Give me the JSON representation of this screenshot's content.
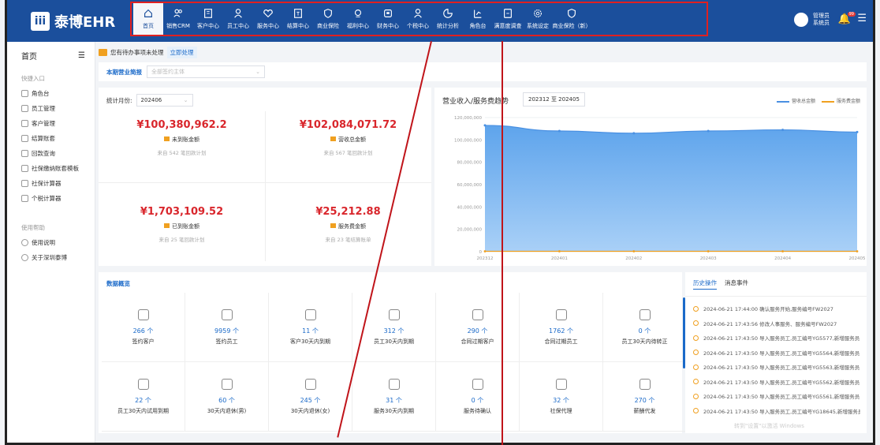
{
  "brand": {
    "name": "泰博EHR",
    "mark": "iii"
  },
  "nav": [
    {
      "label": "首页",
      "icon": "home-icon",
      "active": true
    },
    {
      "label": "销售CRM",
      "icon": "people-icon"
    },
    {
      "label": "客户中心",
      "icon": "building-icon"
    },
    {
      "label": "员工中心",
      "icon": "person-icon"
    },
    {
      "label": "服务中心",
      "icon": "heart-icon"
    },
    {
      "label": "结算中心",
      "icon": "invoice-icon"
    },
    {
      "label": "商业保险",
      "icon": "shield-icon"
    },
    {
      "label": "福利中心",
      "icon": "gift-icon"
    },
    {
      "label": "财务中心",
      "icon": "wallet-icon"
    },
    {
      "label": "个税中心",
      "icon": "tax-person-icon"
    },
    {
      "label": "统计分析",
      "icon": "pie-icon"
    },
    {
      "label": "角色台",
      "icon": "role-icon"
    },
    {
      "label": "满意度调查",
      "icon": "survey-icon"
    },
    {
      "label": "系统设定",
      "icon": "gear-icon"
    },
    {
      "label": "商业保险（新）",
      "icon": "shield-new-icon"
    }
  ],
  "user": {
    "name": "管理员",
    "sub": "系统员"
  },
  "notifications": {
    "count": "99"
  },
  "sidebar": {
    "title": "首页",
    "quick_title": "快捷入口",
    "quick": [
      "角色台",
      "员工管理",
      "客户管理",
      "结算账套",
      "回款查询",
      "社保缴纳账套模板",
      "社保计算器",
      "个税计算器"
    ],
    "help_title": "使用帮助",
    "help": [
      "使用说明",
      "关于深圳泰博"
    ]
  },
  "todo": {
    "text": "您有待办事项未处理",
    "action": "立即处理"
  },
  "business": {
    "label": "本期营业简报",
    "placeholder": "全部签约主体"
  },
  "stats": {
    "month_label": "统计月份:",
    "month": "202406",
    "kpis": [
      {
        "value": "¥100,380,962.2",
        "name": "未到账金额",
        "sub": "来自 542 笔回款计划"
      },
      {
        "value": "¥102,084,071.72",
        "name": "营收总金额",
        "sub": "来自 567 笔回款计划"
      },
      {
        "value": "¥1,703,109.52",
        "name": "已到账金额",
        "sub": "来自 25 笔回款计划"
      },
      {
        "value": "¥25,212.88",
        "name": "服务费金额",
        "sub": "来自 23 笔结算账单"
      }
    ]
  },
  "chart": {
    "title": "营业收入/服务费趋势",
    "range": "202312 至 202405",
    "legend": [
      "营收总金额",
      "服务费金额"
    ]
  },
  "chart_data": {
    "type": "area",
    "title": "营业收入/服务费趋势",
    "x": [
      "202312",
      "202401",
      "202402",
      "202403",
      "202404",
      "202405"
    ],
    "series": [
      {
        "name": "营收总金额",
        "values": [
          113000000,
          108000000,
          106000000,
          108000000,
          109000000,
          107000000
        ],
        "color": "#4a90e2"
      },
      {
        "name": "服务费金额",
        "values": [
          25000,
          25000,
          25000,
          25000,
          25000,
          25000
        ],
        "color": "#f0a020"
      }
    ],
    "yticks": [
      "0",
      "20,000,000",
      "40,000,000",
      "60,000,000",
      "80,000,000",
      "100,000,000",
      "120,000,000"
    ],
    "ylim": [
      0,
      120000000
    ]
  },
  "overview": {
    "title": "数据概览",
    "items": [
      {
        "num": "266 个",
        "label": "签约客户"
      },
      {
        "num": "9959 个",
        "label": "签约员工"
      },
      {
        "num": "11 个",
        "label": "客户30天内到期"
      },
      {
        "num": "312 个",
        "label": "员工30天内到期"
      },
      {
        "num": "290 个",
        "label": "合同过期客户"
      },
      {
        "num": "1762 个",
        "label": "合同过期员工"
      },
      {
        "num": "0 个",
        "label": "员工30天内待转正"
      },
      {
        "num": "22 个",
        "label": "员工30天内试用到期"
      },
      {
        "num": "60 个",
        "label": "30天内退休(男)"
      },
      {
        "num": "245 个",
        "label": "30天内退休(女)"
      },
      {
        "num": "31 个",
        "label": "服务30天内到期"
      },
      {
        "num": "0 个",
        "label": "服务待确认"
      },
      {
        "num": "32 个",
        "label": "社保代理"
      },
      {
        "num": "270 个",
        "label": "薪酬代发"
      }
    ]
  },
  "history": {
    "tabs": [
      "历史操作",
      "消息事件"
    ],
    "rows": [
      "2024-06-21 17:44:00 确认服务开始,服务编号FW2027",
      "2024-06-21 17:43:56 修改人事服务、服务编号FW2027",
      "2024-06-21 17:43:50 导入服务员工,员工编号YG5577,新增服务员...",
      "2024-06-21 17:43:50 导入服务员工,员工编号YG5564,新增服务员...",
      "2024-06-21 17:43:50 导入服务员工,员工编号YG5563,新增服务员...",
      "2024-06-21 17:43:50 导入服务员工,员工编号YG5562,新增服务员...",
      "2024-06-21 17:43:50 导入服务员工,员工编号YG5561,新增服务员...",
      "2024-06-21 17:43:50 导入服务员工,员工编号YG18645,新增服务员..."
    ],
    "watermark": "转到\"设置\"以激活 Windows"
  }
}
